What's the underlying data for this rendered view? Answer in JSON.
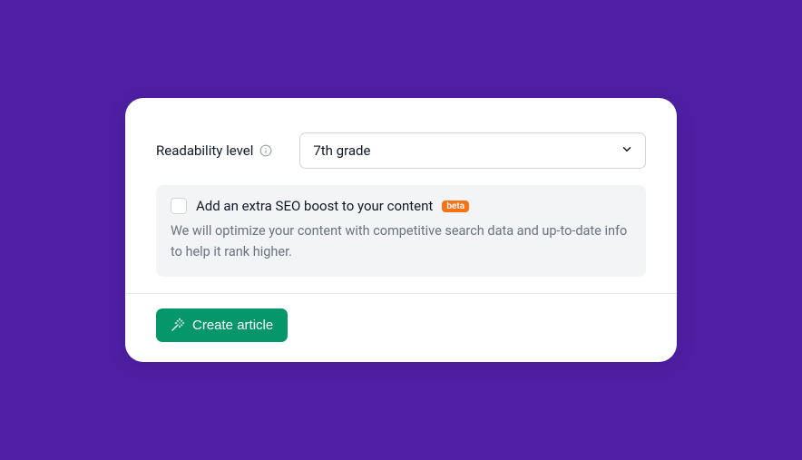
{
  "readability": {
    "label": "Readability level",
    "selected": "7th grade"
  },
  "seo_boost": {
    "label": "Add an extra SEO boost to your content",
    "badge": "beta",
    "description": "We will optimize your content with competitive search data and up-to-date info to help it rank higher."
  },
  "actions": {
    "create_label": "Create article"
  }
}
